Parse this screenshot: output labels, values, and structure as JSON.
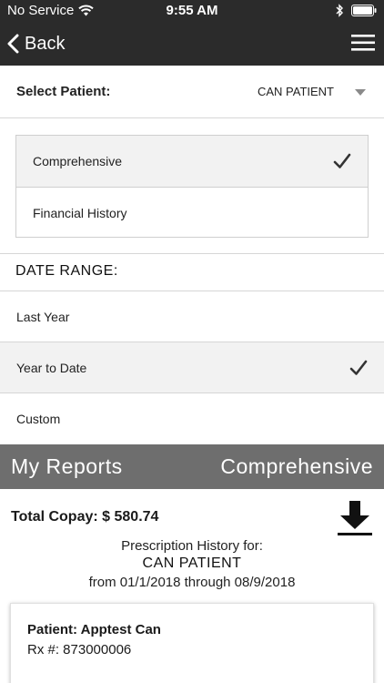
{
  "status_bar": {
    "carrier": "No Service",
    "time": "9:55 AM"
  },
  "nav": {
    "back_label": "Back"
  },
  "select_patient": {
    "label": "Select Patient:",
    "value": "CAN PATIENT"
  },
  "report_types": [
    {
      "label": "Comprehensive",
      "selected": true
    },
    {
      "label": "Financial History",
      "selected": false
    }
  ],
  "date_range": {
    "title": "DATE RANGE:",
    "options": [
      {
        "label": "Last Year",
        "selected": false
      },
      {
        "label": "Year to Date",
        "selected": true
      },
      {
        "label": "Custom",
        "selected": false
      }
    ]
  },
  "reports_header": {
    "title": "My Reports",
    "report_type": "Comprehensive"
  },
  "summary": {
    "total_copay": "Total Copay: $ 580.74",
    "history_title": "Prescription History for:",
    "patient_name": "CAN PATIENT",
    "date_span": "from 01/1/2018 through 08/9/2018"
  },
  "card": {
    "patient": "Patient: Apptest Can",
    "rx": "Rx #: 873000006"
  },
  "colors": {
    "nav_bg": "#2b2b2b",
    "header_bg": "#6e6e6e",
    "selected_bg": "#f2f2f2"
  }
}
